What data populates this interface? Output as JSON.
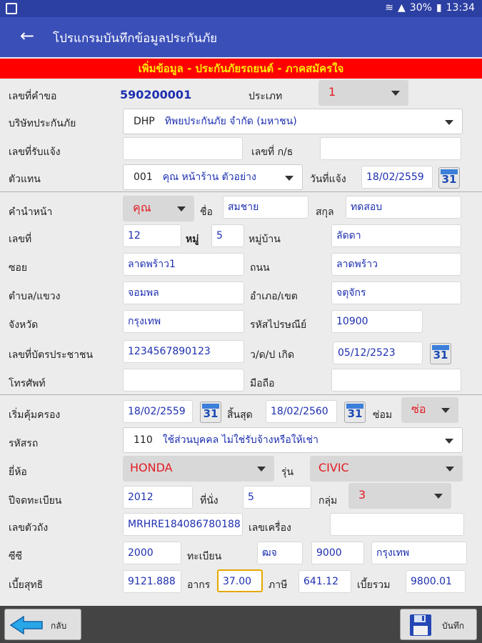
{
  "status": {
    "battery": "30%",
    "time": "13:34"
  },
  "appbar": {
    "title": "โปรแกรมบันทึกข้อมูลประกันภัย"
  },
  "banner": "เพิ่มข้อมูล - ประกันภัยรถยนต์ - ภาคสมัครใจ",
  "labels": {
    "request_no": "เลขที่คำขอ",
    "type": "ประเภท",
    "insurer": "บริษัทประกันภัย",
    "notify_no": "เลขที่รับแจ้ง",
    "kb_no": "เลขที่ ก/ธ",
    "agent": "ตัวแทน",
    "notify_date": "วันที่แจ้ง",
    "prefix": "คำนำหน้า",
    "first_name": "ชื่อ",
    "last_name": "สกุล",
    "house_no": "เลขที่",
    "moo": "หมู่",
    "village": "หมู่บ้าน",
    "soi": "ซอย",
    "road": "ถนน",
    "subdistrict": "ตำบล/แขวง",
    "district": "อำเภอ/เขต",
    "province": "จังหวัด",
    "postcode": "รหัสไปรษณีย์",
    "id_card": "เลขที่บัตรประชาชน",
    "birth_date": "ว/ด/ป เกิด",
    "phone": "โทรศัพท์",
    "mobile": "มือถือ",
    "coverage_start": "เริ่มคุ้มครอง",
    "coverage_end": "สิ้นสุด",
    "repair": "ซ่อม",
    "car_code": "รหัสรถ",
    "brand": "ยี่ห้อ",
    "model": "รุ่น",
    "reg_year": "ปีจดทะเบียน",
    "seats": "ที่นั่ง",
    "group": "กลุ่ม",
    "chassis": "เลขตัวถัง",
    "engine": "เลขเครื่อง",
    "cc": "ซีซี",
    "registration": "ทะเบียน",
    "net_premium": "เบี้ยสุทธิ",
    "stamp": "อากร",
    "tax": "ภาษี",
    "total_premium": "เบี้ยรวม"
  },
  "values": {
    "request_no": "590200001",
    "type": "1",
    "insurer_code": "DHP",
    "insurer_name": "ทิพยประกันภัย จำกัด (มหาชน)",
    "notify_no": "",
    "kb_no": "",
    "agent_code": "001",
    "agent_name": "คุณ หน้าร้าน ตัวอย่าง",
    "notify_date": "18/02/2559",
    "prefix": "คุณ",
    "first_name": "สมชาย",
    "last_name": "ทดสอบ",
    "house_no": "12",
    "moo": "5",
    "village": "ลัดดา",
    "soi": "ลาดพร้าว1",
    "road": "ลาดพร้าว",
    "subdistrict": "จอมพล",
    "district": "จตุจักร",
    "province": "กรุงเทพ",
    "postcode": "10900",
    "id_card": "1234567890123",
    "birth_date": "05/12/2523",
    "phone": "",
    "mobile": "",
    "coverage_start": "18/02/2559",
    "coverage_end": "18/02/2560",
    "repair": "ซ่อ",
    "car_code": "110",
    "car_desc": "ใช้ส่วนบุคคล ไม่ใช่รับจ้างหรือให้เช่า",
    "brand": "HONDA",
    "model": "CIVIC",
    "reg_year": "2012",
    "seats": "5",
    "group": "3",
    "chassis": "MRHRE184086780188",
    "engine": "",
    "cc": "2000",
    "reg_prefix": "ฒจ",
    "reg_number": "9000",
    "reg_province": "กรุงเทพ",
    "net_premium": "9121.888",
    "stamp": "37.00",
    "tax": "641.12",
    "total_premium": "9800.01"
  },
  "calendar_glyph": "31",
  "bottom": {
    "back": "กลับ",
    "save": "บันทึก"
  }
}
